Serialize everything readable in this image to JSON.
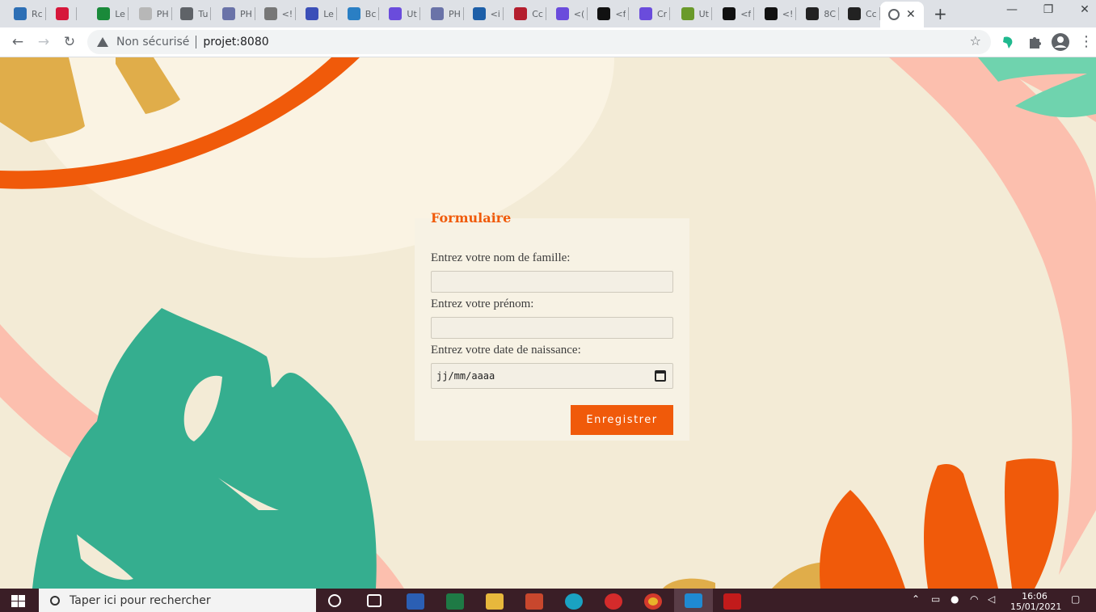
{
  "browser": {
    "tabs": [
      {
        "label": "Rc",
        "icon": "browser-icon",
        "color": "#2d6fb5"
      },
      {
        "label": "",
        "icon": "app-icon",
        "color": "#d6173a"
      },
      {
        "label": "Le",
        "icon": "globe-icon",
        "color": "#1a8a3a"
      },
      {
        "label": "PH",
        "icon": "doc-icon",
        "color": "#b7b7b7"
      },
      {
        "label": "Tu",
        "icon": "globe-icon",
        "color": "#5f6368"
      },
      {
        "label": "PH",
        "icon": "php-icon",
        "color": "#6a73a8"
      },
      {
        "label": "<!",
        "icon": "code-icon",
        "color": "#777777"
      },
      {
        "label": "Le",
        "icon": "ap-icon",
        "color": "#3b4fb8"
      },
      {
        "label": "Bc",
        "icon": "php-icon",
        "color": "#2a7fc4"
      },
      {
        "label": "Ut",
        "icon": "d-icon",
        "color": "#6a4cdc"
      },
      {
        "label": "PH",
        "icon": "php-icon",
        "color": "#6a73a8"
      },
      {
        "label": "<i",
        "icon": "triangle-icon",
        "color": "#1d5fa8"
      },
      {
        "label": "Cc",
        "icon": "wix-icon",
        "color": "#b41e2e"
      },
      {
        "label": "<(",
        "icon": "d-icon",
        "color": "#6a4cdc"
      },
      {
        "label": "<f",
        "icon": "codepen-icon",
        "color": "#111111"
      },
      {
        "label": "Cr",
        "icon": "d-icon",
        "color": "#6a4cdc"
      },
      {
        "label": "Ut",
        "icon": "leaf-icon",
        "color": "#6a9a2a"
      },
      {
        "label": "<f",
        "icon": "codepen-icon",
        "color": "#111111"
      },
      {
        "label": "<!",
        "icon": "codepen-icon",
        "color": "#111111"
      },
      {
        "label": "8C",
        "icon": "f-icon",
        "color": "#222222"
      },
      {
        "label": "Cc",
        "icon": "codepen-icon",
        "color": "#222222"
      }
    ],
    "active_tab_close": "✕",
    "new_tab": "+",
    "window": {
      "minimize": "—",
      "maximize": "❐",
      "close": "✕"
    },
    "nav": {
      "back": "←",
      "forward": "→",
      "reload": "↻"
    },
    "address": {
      "security": "Non sécurisé",
      "url": "projet:8080"
    },
    "bookmark_star": "☆"
  },
  "form": {
    "title": "Formulaire",
    "last_name_label": "Entrez votre nom de famille:",
    "last_name_value": "",
    "first_name_label": "Entrez votre prénom:",
    "first_name_value": "",
    "birthdate_label": "Entrez votre date de naissance:",
    "birthdate_placeholder": "jj/mm/aaaa",
    "submit_label": "Enregistrer"
  },
  "colors": {
    "accent": "#f05a0a",
    "background": "#f3ebd6",
    "leaf_green": "#35ae8f",
    "pink": "#fcbfae",
    "mustard": "#e0ad4a"
  },
  "taskbar": {
    "search_placeholder": "Taper ici pour rechercher",
    "time": "16:06",
    "date": "15/01/2021"
  }
}
